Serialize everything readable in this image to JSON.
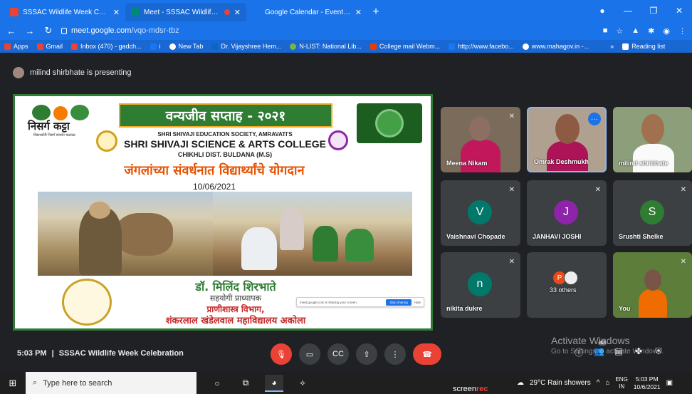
{
  "browser": {
    "tabs": [
      {
        "title": "SSSAC Wildlife Week Celebration",
        "favicon_color": "#ea4335"
      },
      {
        "title": "Meet - SSSAC Wildlife Week",
        "favicon_color": "#00897b",
        "active": true
      },
      {
        "title": "Google Calendar - Event details",
        "favicon_color": "#1a73e8"
      }
    ],
    "url_host": "meet.google.com",
    "url_path": "/vqo-mdsr-tbz",
    "bookmarks": [
      "Apps",
      "Gmail",
      "Inbox (470) - gadch...",
      "i",
      "New Tab",
      "Dr. Vijayshree Hem...",
      "N-LIST: National Lib...",
      "College mail Webm...",
      "http://www.facebo...",
      "www.mahagov.in -..."
    ],
    "reading_list": "Reading list",
    "overflow": "»"
  },
  "meet": {
    "presenting_text": "milind shirbhate is presenting",
    "meeting_time": "5:03 PM",
    "meeting_separator": "|",
    "meeting_title": "SSSAC Wildlife Week Celebration",
    "accent": "#1a73e8",
    "hangup_color": "#ea4335"
  },
  "slide": {
    "logo_text": "निसर्ग कट्टा",
    "logo_sub": "विद्यार्थ्यांनी निसर्ग संवर्धन चळवळ",
    "week_title": "वन्यजीव सप्ताह - २०२१",
    "society": "SHRI SHIVAJI EDUCATION SOCIETY, AMRAVATI'S",
    "college": "SHRI SHIVAJI SCIENCE & ARTS COLLEGE",
    "place": "CHIKHLI  DIST. BULDANA (M.S)",
    "marathi_title": "जंगलांच्या संवर्धनात विद्यार्थ्यांचे योगदान",
    "date": "10/06/2021",
    "speaker_name": "डॉ. मिलिंद शिरभाते",
    "speaker_role": "सहयोगी प्राध्यापक",
    "speaker_dept": "प्राणीशास्त्र विभाग,",
    "speaker_college": "शंकरलाल खंडेलवाल महाविद्यालय अकोला",
    "share_text": "meet.google.com is sharing your screen.",
    "stop_sharing": "Stop sharing",
    "hide": "Hide"
  },
  "participants": [
    {
      "name": "Meena Nikam",
      "type": "video",
      "muted": true
    },
    {
      "name": "Omrak Deshmukh",
      "type": "video",
      "muted": false,
      "highlighted": true
    },
    {
      "name": "milind shirbhate",
      "type": "video",
      "muted": false
    },
    {
      "name": "Vaishnavi Chopade",
      "initial": "V",
      "color": "#00796b",
      "muted": true
    },
    {
      "name": "JANHAVI JOSHI",
      "initial": "J",
      "color": "#8e24aa",
      "muted": true
    },
    {
      "name": "Srushti Shelke",
      "initial": "S",
      "color": "#2e7d32",
      "muted": true
    },
    {
      "name": "nikita dukre",
      "initial": "n",
      "color": "#00796b",
      "muted": true
    },
    {
      "name": "33 others",
      "initial": "P",
      "color": "#e64a19",
      "muted": false
    },
    {
      "name": "You",
      "type": "video",
      "muted": true
    }
  ],
  "more_options": "···",
  "people_count": "42",
  "watermark": {
    "line1": "Activate Windows",
    "line2": "Go to Settings to activate Windows."
  },
  "taskbar": {
    "search_placeholder": "Type here to search",
    "screenrec_prefix": "screen",
    "screenrec_suffix": "rec",
    "weather": "29°C  Rain showers",
    "lang1": "ENG",
    "lang2": "IN",
    "time": "5:03 PM",
    "date": "10/6/2021"
  }
}
